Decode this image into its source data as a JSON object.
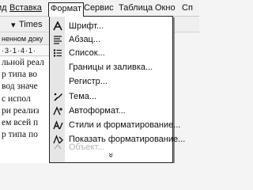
{
  "menubar": {
    "items": [
      {
        "label": "ид"
      },
      {
        "label": "Вставка"
      },
      {
        "label": "Формат"
      },
      {
        "label": "Сервис"
      },
      {
        "label": "Таблица"
      },
      {
        "label": "Окно"
      },
      {
        "label": "Сп"
      }
    ]
  },
  "toolbar": {
    "font_name": "Times"
  },
  "document": {
    "name": "ненном доку",
    "ruler": "·3·1·4·1·",
    "lines": [
      "льной реал",
      "р типа во",
      "вод значе",
      "с испол",
      "ри реализ",
      "ем всей п",
      "р типа по"
    ]
  },
  "format_menu": {
    "items": [
      {
        "label": "Шрифт...",
        "icon": "font-icon",
        "disabled": false
      },
      {
        "label": "Абзац...",
        "icon": "paragraph-icon",
        "disabled": false
      },
      {
        "label": "Список...",
        "icon": "list-icon",
        "disabled": false
      },
      {
        "label": "Границы и заливка...",
        "icon": "",
        "disabled": false
      },
      {
        "label": "Регистр...",
        "icon": "",
        "disabled": false
      },
      {
        "label": "Тема...",
        "icon": "theme-icon",
        "disabled": false
      },
      {
        "label": "Автоформат...",
        "icon": "autoformat-icon",
        "disabled": false
      },
      {
        "label": "Стили и форматирование...",
        "icon": "styles-icon",
        "disabled": false
      },
      {
        "label": "Показать форматирование...",
        "icon": "reveal-formatting-icon",
        "disabled": false
      },
      {
        "label": "Объект...",
        "icon": "object-icon",
        "disabled": true
      }
    ],
    "more_glyph": "»"
  }
}
